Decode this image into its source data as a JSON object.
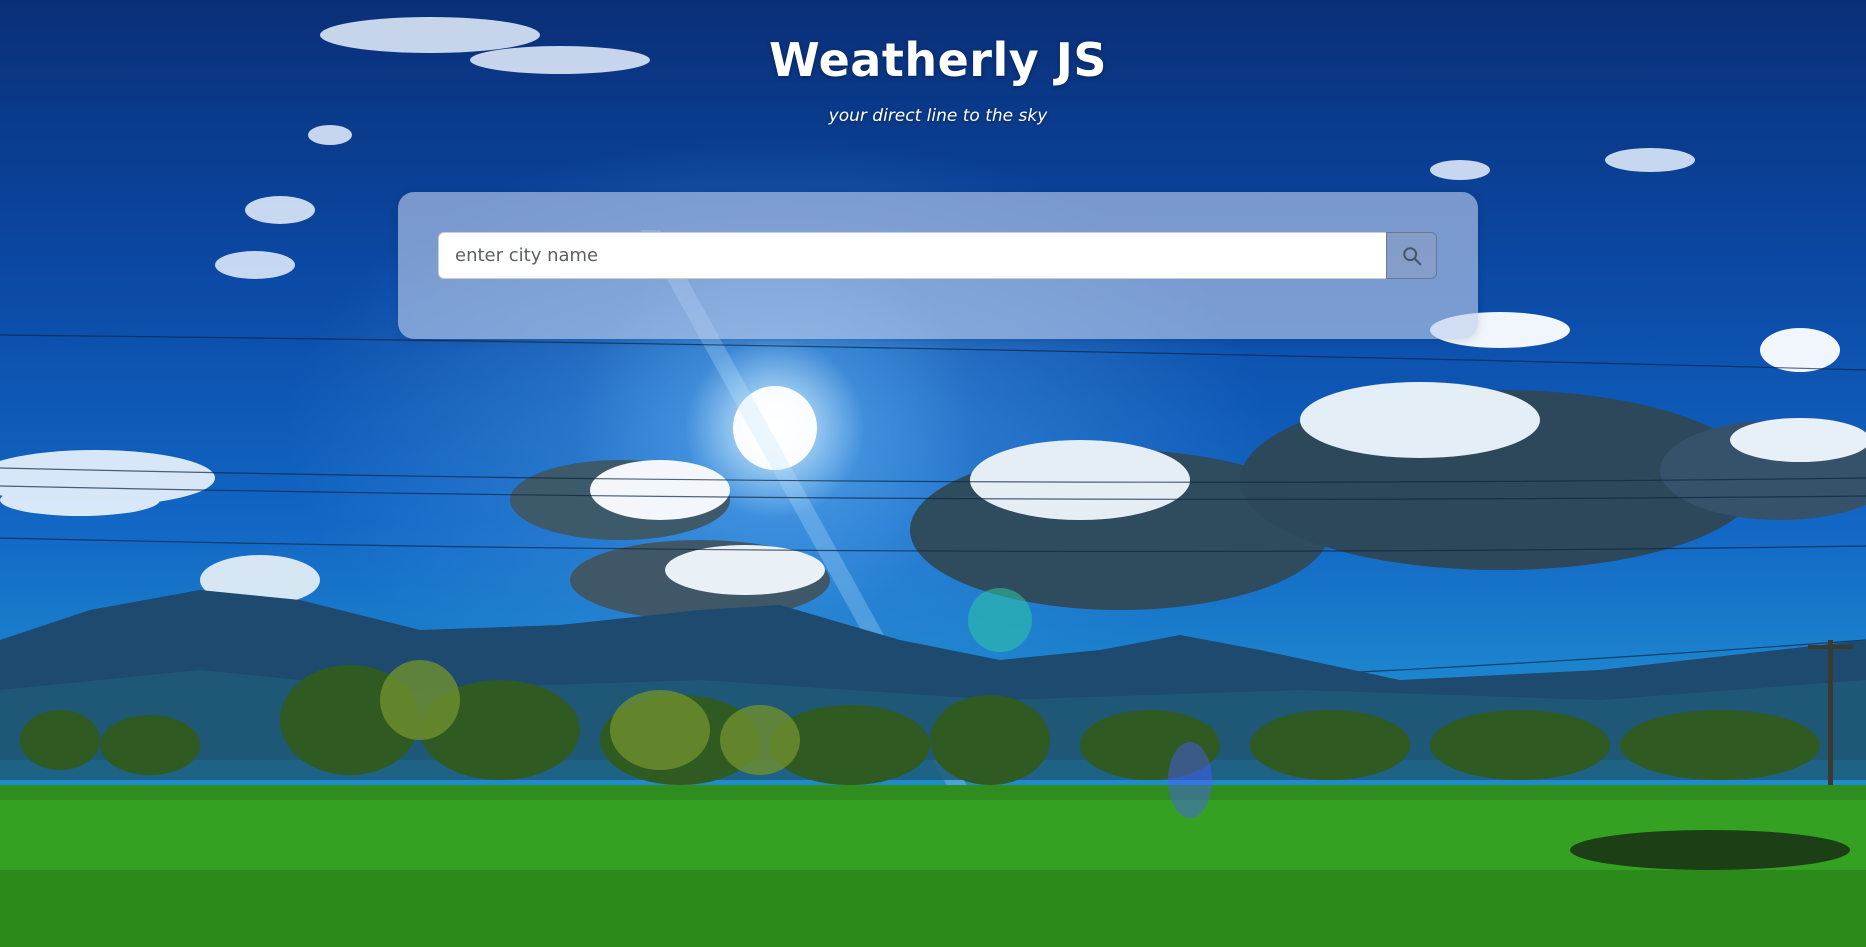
{
  "app": {
    "title": "Weatherly JS",
    "tagline": "your direct line to the sky"
  },
  "search": {
    "placeholder": "enter city name",
    "value": "",
    "button_icon": "search-icon"
  },
  "colors": {
    "card_bg": "#becdeb",
    "title_text": "#ffffff",
    "search_button_icon": "#4a5568"
  }
}
